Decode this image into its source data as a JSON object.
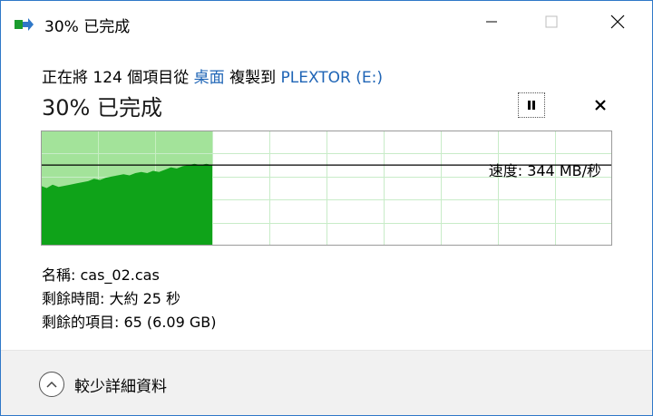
{
  "window": {
    "title": "30% 已完成"
  },
  "header": {
    "prefix": "正在將 124 個項目從 ",
    "source": "桌面",
    "middle": " 複製到 ",
    "destination": "PLEXTOR (E:)"
  },
  "progress": {
    "label": "30% 已完成",
    "percent": 30,
    "speed_label": "速度: 344 MB/秒",
    "speed_history": [
      52,
      50,
      53,
      51,
      52,
      53,
      54,
      55,
      56,
      58,
      57,
      59,
      60,
      61,
      62,
      61,
      63,
      64,
      63,
      65,
      64,
      66,
      68,
      67,
      69,
      70,
      71,
      70,
      71,
      70
    ]
  },
  "details": {
    "name": "名稱: cas_02.cas",
    "time_remaining": "剩餘時間: 大約 25 秒",
    "items_remaining": "剩餘的項目: 65 (6.09 GB)"
  },
  "footer": {
    "less_details": "較少詳細資料"
  },
  "colors": {
    "grid_line": "#c8ecc8",
    "progress_fill": "#a3e39a",
    "speed_fill": "#0fa319",
    "border": "#2f78c8",
    "link": "#1f65b6"
  }
}
